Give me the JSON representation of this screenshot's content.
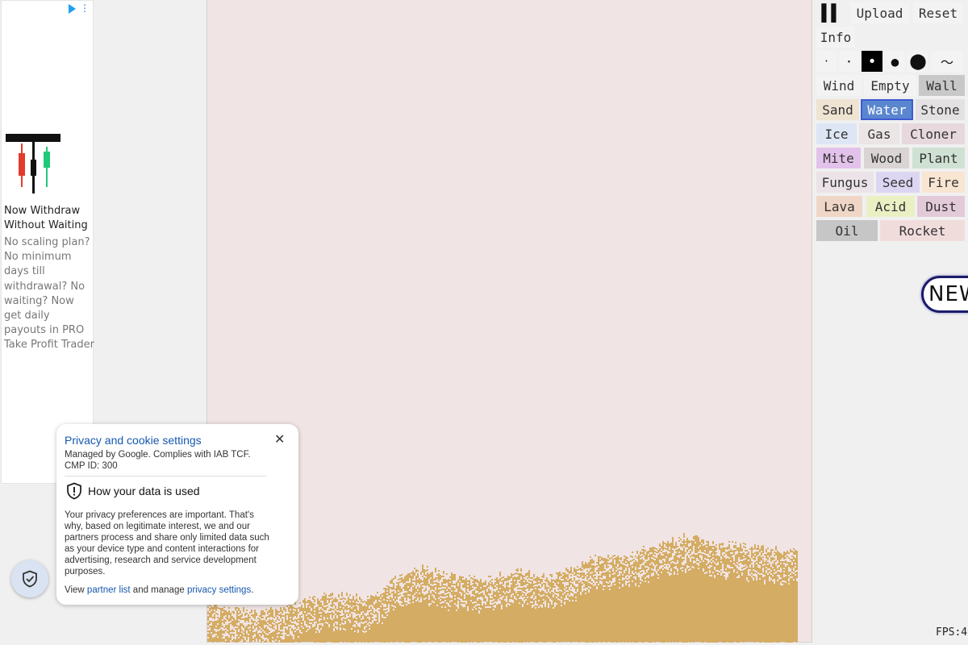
{
  "ad": {
    "headline": "Now Withdraw Without Waiting",
    "body": "No scaling plan? No minimum days till withdrawal? No waiting? Now get daily payouts in PRO Take Profit Trader"
  },
  "toolbar": {
    "pause_label": "▌▌",
    "upload_label": "Upload",
    "reset_label": "Reset",
    "info_label": "Info"
  },
  "brushes": {
    "size1": "·",
    "size2": "·",
    "size3": "•",
    "size4": "●",
    "size5": "⬤",
    "freehand": "〜"
  },
  "elements": {
    "wind": "Wind",
    "empty": "Empty",
    "wall": "Wall",
    "sand": "Sand",
    "water": "Water",
    "stone": "Stone",
    "ice": "Ice",
    "gas": "Gas",
    "cloner": "Cloner",
    "mite": "Mite",
    "wood": "Wood",
    "plant": "Plant",
    "fungus": "Fungus",
    "seed": "Seed",
    "fire": "Fire",
    "lava": "Lava",
    "acid": "Acid",
    "dust": "Dust",
    "oil": "Oil",
    "rocket": "Rocket"
  },
  "element_colors": {
    "wind": "#f3f3f3",
    "empty": "#f3f3f3",
    "wall": "#c8c8c8",
    "sand": "#efe3d2",
    "water": "#5a86cf",
    "stone": "#e3e1e1",
    "ice": "#dde6f5",
    "gas": "#ebe5e5",
    "cloner": "#e6d8dc",
    "mite": "#e2c2ea",
    "wood": "#dad4d4",
    "plant": "#cfe1d3",
    "fungus": "#ebe3e7",
    "seed": "#ddd6f3",
    "fire": "#f8e5d2",
    "lava": "#f0d6c6",
    "acid": "#eaf0c3",
    "dust": "#e3cad8",
    "oil": "#c6c6c6",
    "rocket": "#f1dcdc"
  },
  "selected_element": "water",
  "selected_brush": "size3",
  "new_badge": "NEW",
  "fps": "FPS:4",
  "privacy": {
    "title": "Privacy and cookie settings",
    "managed": "Managed by Google. Complies with IAB TCF. CMP ID: 300",
    "how_heading": "How your data is used",
    "paragraph": "Your privacy preferences are important. That's why, based on legitimate interest, we and our partners process and share only limited data such as your device type and content interactions for advertising, research and service development purposes.",
    "view_prefix": "View ",
    "partner_link": "partner list",
    "view_middle": " and manage ",
    "settings_link": "privacy settings",
    "view_suffix": "."
  },
  "colors": {
    "sandbox_bg": "#f0e4e4",
    "sand_pixels": "#d4ac63",
    "link": "#1558b0"
  }
}
